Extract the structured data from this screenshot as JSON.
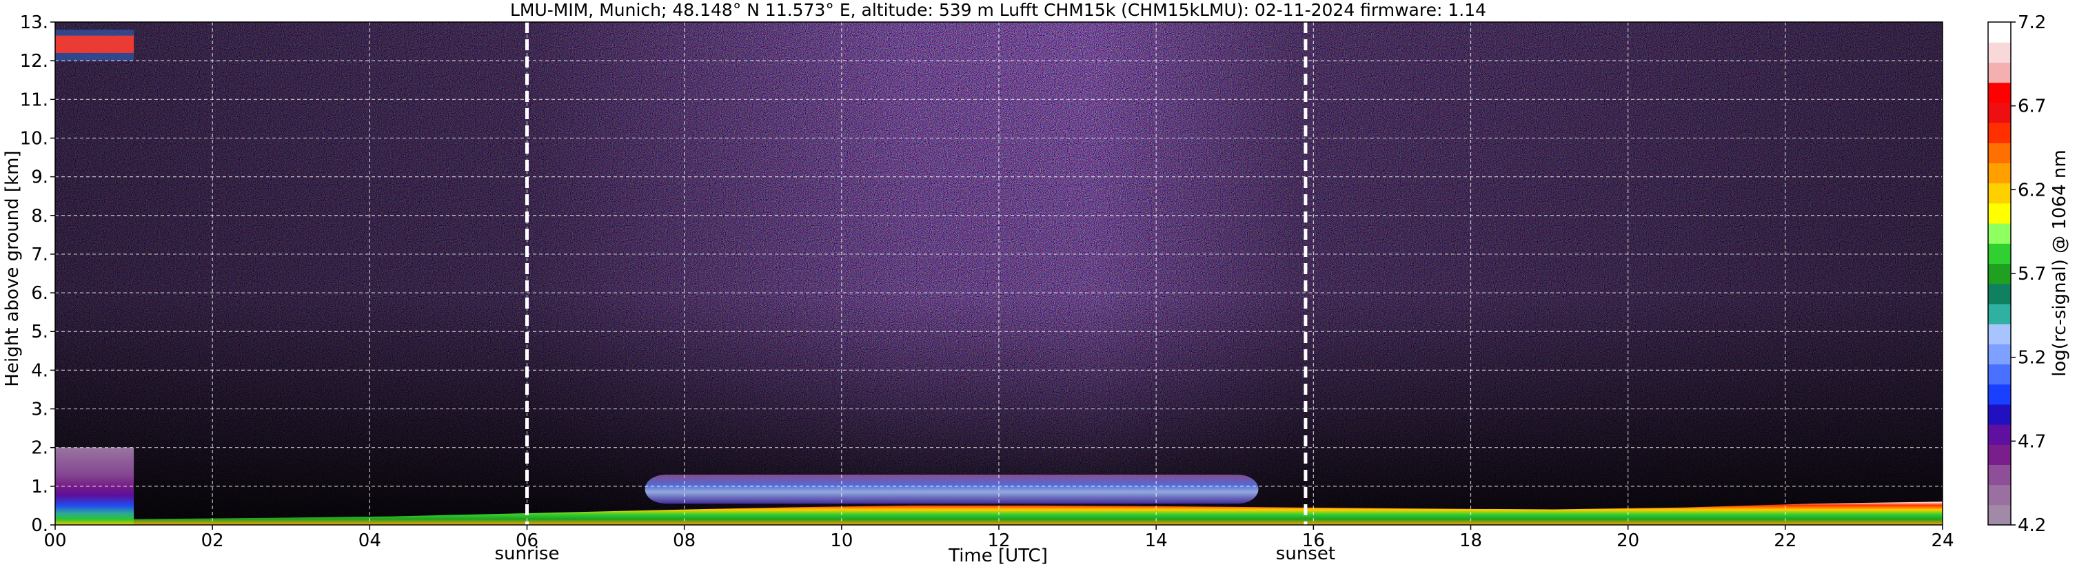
{
  "chart_data": {
    "type": "heatmap",
    "title": "LMU-MIM, Munich; 48.148° N 11.573° E, altitude: 539 m    Lufft CHM15k (CHM15kLMU): 02-11-2024    firmware: 1.14",
    "xlabel": "Time [UTC]",
    "ylabel": "Height above ground [km]",
    "xlim": [
      0,
      24
    ],
    "ylim": [
      0,
      13
    ],
    "x_ticks": [
      "00",
      "02",
      "04",
      "06",
      "08",
      "10",
      "12",
      "14",
      "16",
      "18",
      "20",
      "22",
      "24"
    ],
    "y_ticks": [
      "0.",
      "1.",
      "2.",
      "3.",
      "4.",
      "5.",
      "6.",
      "7.",
      "8.",
      "9.",
      "10.",
      "11.",
      "12.",
      "13."
    ],
    "grid": true,
    "events": [
      {
        "label": "sunrise",
        "time_h": 6.0
      },
      {
        "label": "sunset",
        "time_h": 15.9
      }
    ],
    "colorbar": {
      "label": "log(rc-signal) @ 1064 nm",
      "range": [
        4.2,
        7.2
      ],
      "ticks": [
        "4.2",
        "4.7",
        "5.2",
        "5.7",
        "6.2",
        "6.7",
        "7.2"
      ],
      "colors": [
        "#a08aa8",
        "#9a70a0",
        "#8f4f98",
        "#7a1e8c",
        "#6010a0",
        "#2010c0",
        "#1a40ff",
        "#4a70ff",
        "#7ea0ff",
        "#a8c4ff",
        "#30b0a0",
        "#108060",
        "#20a020",
        "#30d030",
        "#90ff60",
        "#ffff00",
        "#ffd000",
        "#ffa000",
        "#ff7000",
        "#ff3000",
        "#ee1010",
        "#ff0000",
        "#f4b0b0",
        "#f8d8d8",
        "#ffffff"
      ]
    },
    "layers": [
      {
        "name": "background noise",
        "x": [
          0,
          24
        ],
        "y": [
          0.15,
          13
        ]
      },
      {
        "name": "pre-01 UTC aerosol/cloud layer",
        "x": [
          0,
          1.0
        ],
        "y": [
          0,
          2.0
        ]
      },
      {
        "name": "high cloud",
        "x": [
          0,
          1.0
        ],
        "y": [
          12.0,
          12.8
        ]
      },
      {
        "name": "residual layer",
        "x": [
          7.5,
          15.3
        ],
        "y": [
          0.55,
          1.3
        ]
      },
      {
        "name": "surface boundary layer",
        "x": [
          1.0,
          24
        ],
        "y": [
          0,
          0.6
        ]
      }
    ]
  }
}
